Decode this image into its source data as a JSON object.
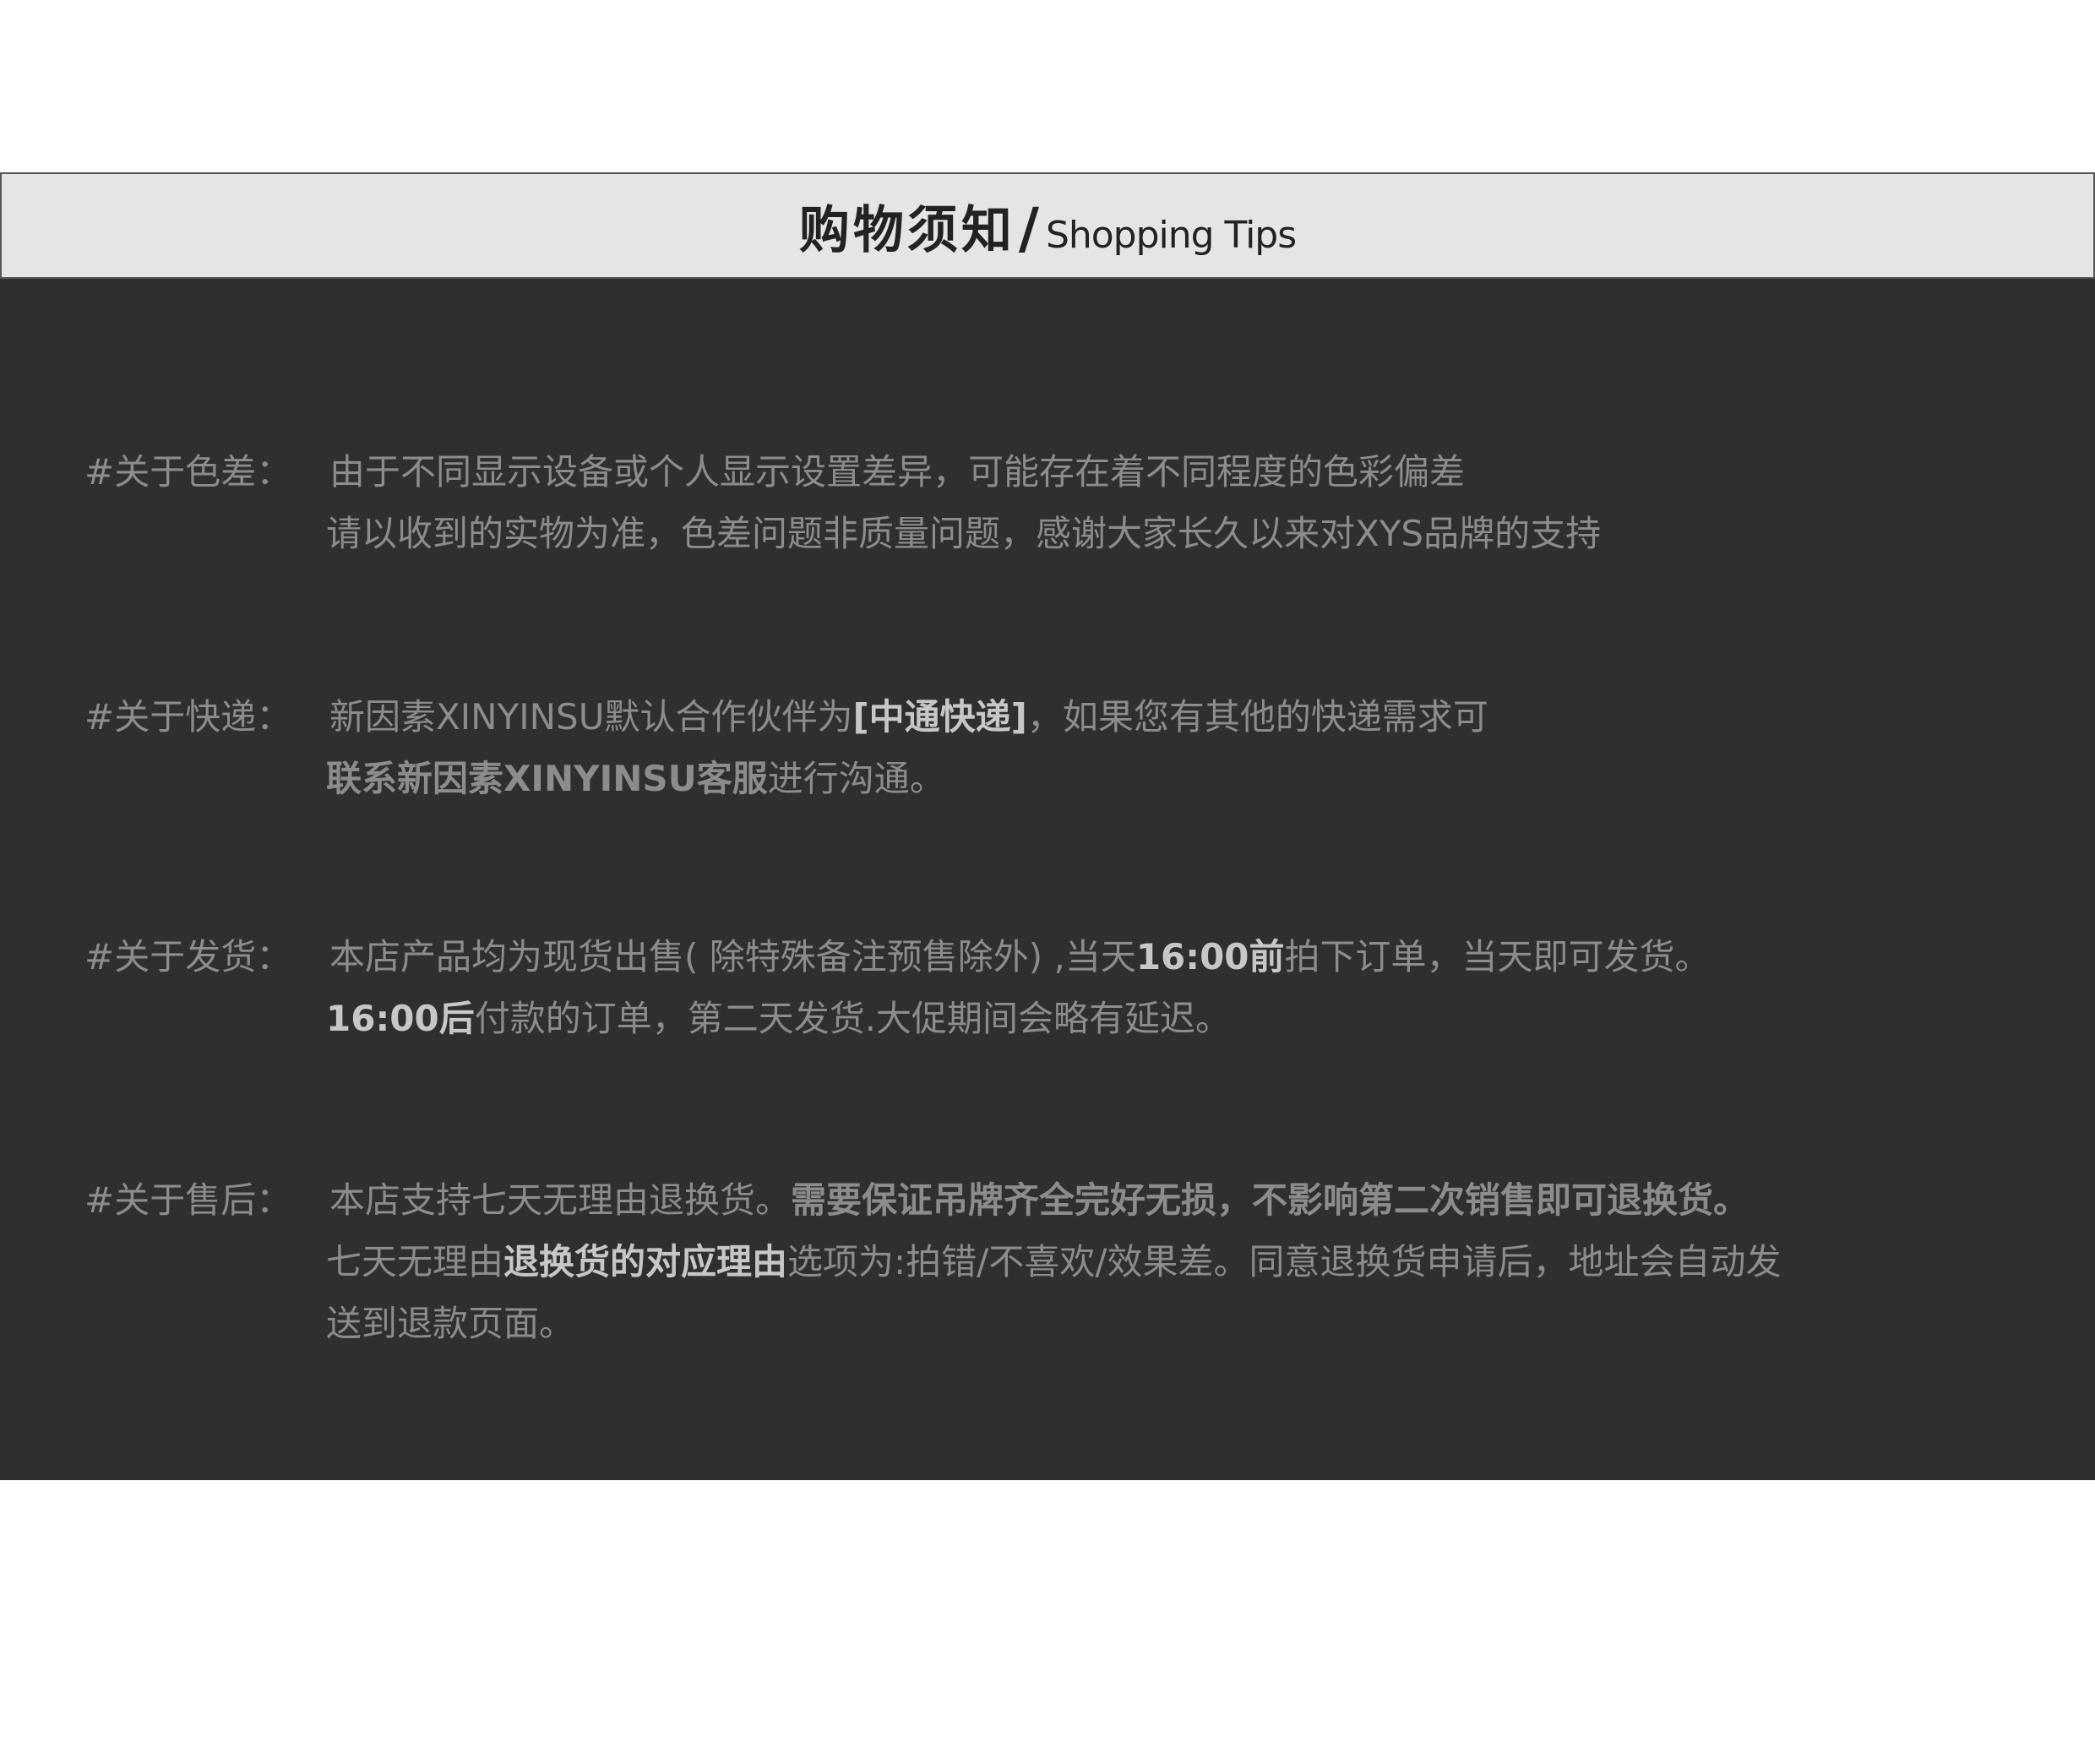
{
  "header": {
    "title_cn": "购物须知",
    "slash": "/",
    "title_en": "Shopping Tips"
  },
  "tips": {
    "color": {
      "label": "#关于色差：",
      "line1": "由于不同显示设备或个人显示设置差异，可能存在着不同程度的色彩偏差",
      "line2": "请以收到的实物为准，色差问题非质量问题，感谢大家长久以来对XYS品牌的支持"
    },
    "express": {
      "label": "#关于快递：",
      "line1_a": "新因素XINYINSU默认合作伙伴为",
      "line1_hl": "[中通快递]",
      "line1_b": "，如果您有其他的快递需求可",
      "line2_hl": "联系新因素XINYINSU客服",
      "line2_b": "进行沟通。"
    },
    "shipping": {
      "label": "#关于发货：",
      "line1_a": "本店产品均为现货出售( 除特殊备注预售除外) ,当天",
      "line1_hl": "16:00前",
      "line1_b": "拍下订单，当天即可发货。",
      "line2_hl": "16:00后",
      "line2_b": "付款的订单，第二天发货.大促期间会略有延迟。"
    },
    "aftersale": {
      "label": "#关于售后：",
      "line1_a": "本店支持七天无理由退换货。",
      "line1_hl": "需要保证吊牌齐全完好无损，不影响第二次销售即可退换货。",
      "line2_a": "七天无理由",
      "line2_hl": "退换货的对应理由",
      "line2_b": "选项为:拍错/不喜欢/效果差。同意退换货申请后，地址会自动发",
      "line3": "送到退款页面。"
    }
  }
}
